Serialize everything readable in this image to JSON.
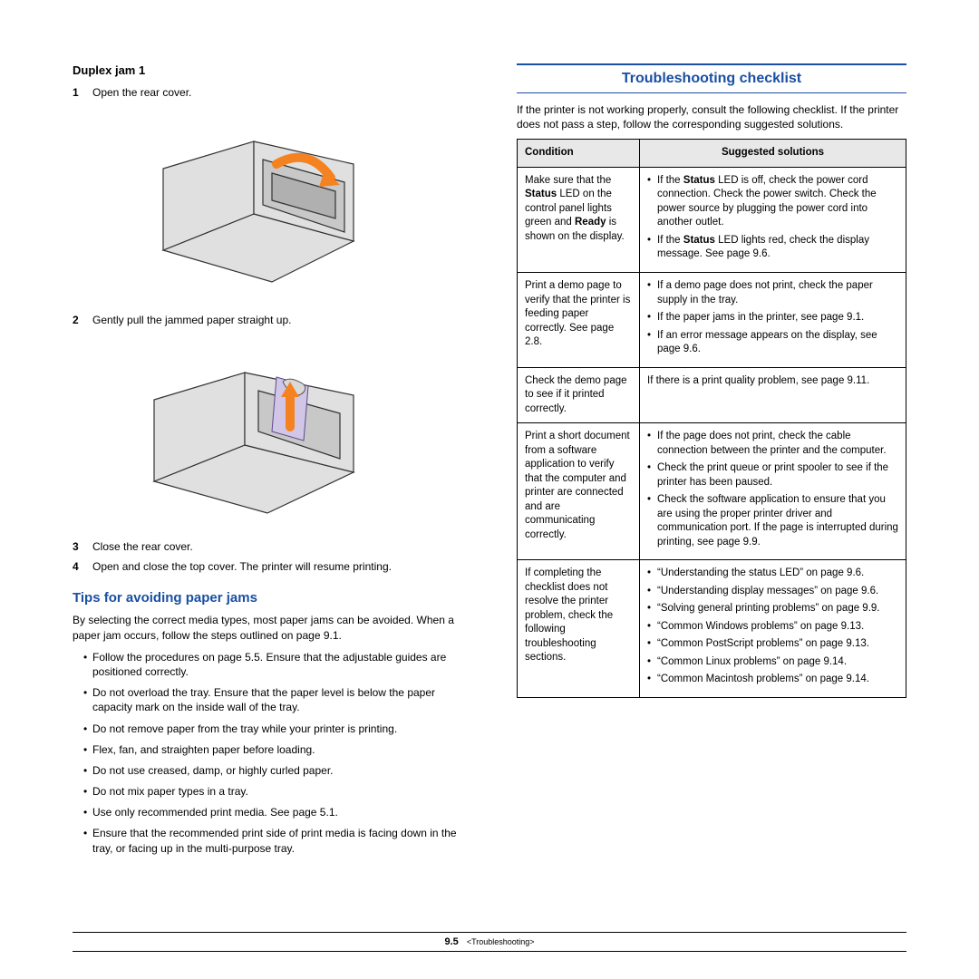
{
  "left": {
    "duplex_head": "Duplex jam 1",
    "steps": [
      "Open the rear cover.",
      "Gently pull the jammed paper straight up.",
      "Close the rear cover.",
      "Open and close the top cover. The printer will resume printing."
    ],
    "tips_head": "Tips for avoiding paper jams",
    "tips_intro": "By selecting the correct media types, most paper jams can be avoided. When a paper jam occurs, follow the steps outlined on page 9.1.",
    "tips": [
      "Follow the procedures on page 5.5. Ensure that the adjustable guides are positioned correctly.",
      "Do not overload the tray. Ensure that the paper level is below the paper capacity mark on the inside wall of the tray.",
      "Do not remove paper from the tray while your printer is printing.",
      "Flex, fan, and straighten paper before loading.",
      "Do not use creased, damp, or highly curled paper.",
      "Do not mix paper types in a tray.",
      "Use only recommended print media. See page 5.1.",
      "Ensure that the recommended print side of print media is facing down in the tray, or facing up in the multi-purpose tray."
    ]
  },
  "right": {
    "heading": "Troubleshooting checklist",
    "intro": "If the printer is not working properly, consult the following checklist. If the printer does not pass a step, follow the corresponding suggested solutions.",
    "th1": "Condition",
    "th2": "Suggested solutions",
    "rows": [
      {
        "cond_html": "Make sure that the <b>Status</b> LED on the control panel lights green and <b>Ready</b> is shown on the display.",
        "sol_list_html": [
          "If the <b>Status</b> LED is off, check the power cord connection. Check the power switch. Check the power source by plugging the power cord into another outlet.",
          "If the <b>Status</b> LED lights red, check the display message. See page 9.6."
        ]
      },
      {
        "cond_html": "Print a demo page to verify that the printer is feeding paper correctly. See page 2.8.",
        "sol_list_html": [
          "If a demo page does not print, check the paper supply in the tray.",
          "If the paper jams in the printer, see page 9.1.",
          "If an error message appears on the display, see page 9.6."
        ]
      },
      {
        "cond_html": "Check the demo page to see if it printed correctly.",
        "sol_plain": "If there is a print quality problem, see page 9.11."
      },
      {
        "cond_html": "Print a short document from a software application to verify that the computer and printer are connected and are communicating correctly.",
        "sol_list_html": [
          "If the page does not print, check the cable connection between the printer and the computer.",
          "Check the print queue or print spooler to see if the printer has been paused.",
          "Check the software application to ensure that you are using the proper printer driver and communication port. If the page is interrupted during printing, see page 9.9."
        ]
      },
      {
        "cond_html": "If completing the checklist does not resolve the printer problem, check the following troubleshooting sections.",
        "sol_list_html": [
          "“Understanding the status LED” on page 9.6.",
          "“Understanding display messages” on page 9.6.",
          "“Solving general printing problems” on page 9.9.",
          "“Common Windows problems” on page 9.13.",
          "“Common PostScript problems” on page 9.13.",
          "“Common Linux problems” on page 9.14.",
          "“Common Macintosh problems” on page 9.14."
        ]
      }
    ]
  },
  "footer": {
    "page": "9.5",
    "chapter": "<Troubleshooting>"
  }
}
